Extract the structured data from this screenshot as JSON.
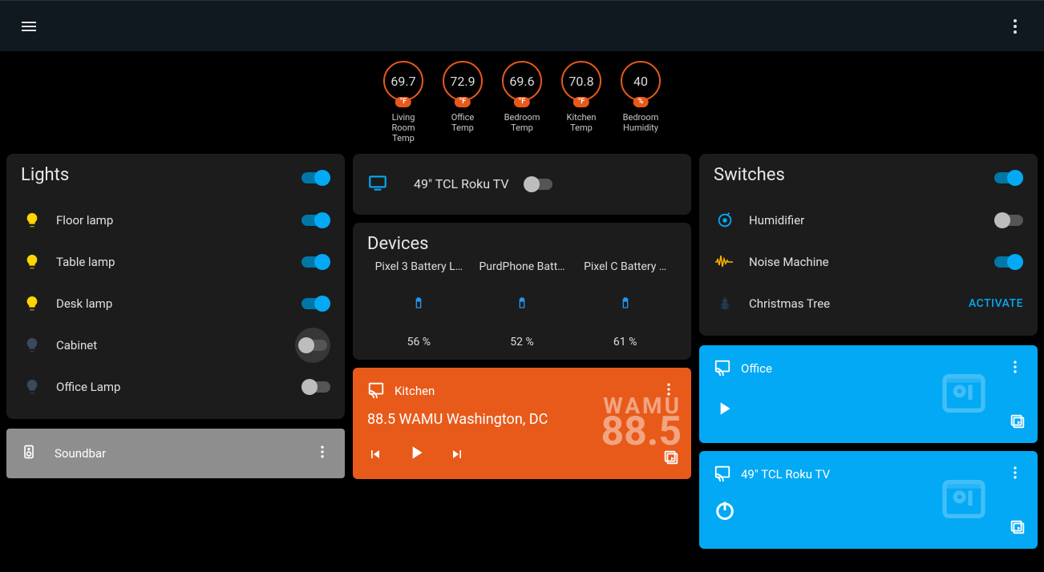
{
  "sensors": [
    {
      "value": "69.7",
      "unit": "°F",
      "label": "Living\nRoom\nTemp"
    },
    {
      "value": "72.9",
      "unit": "°F",
      "label": "Office\nTemp"
    },
    {
      "value": "69.6",
      "unit": "°F",
      "label": "Bedroom\nTemp"
    },
    {
      "value": "70.8",
      "unit": "°F",
      "label": "Kitchen\nTemp"
    },
    {
      "value": "40",
      "unit": "%",
      "label": "Bedroom\nHumidity"
    }
  ],
  "lights": {
    "title": "Lights",
    "master_on": true,
    "items": [
      {
        "name": "Floor lamp",
        "on": true
      },
      {
        "name": "Table lamp",
        "on": true
      },
      {
        "name": "Desk lamp",
        "on": true
      },
      {
        "name": "Cabinet",
        "on": false,
        "halo": true
      },
      {
        "name": "Office Lamp",
        "on": false
      }
    ]
  },
  "soundbar": {
    "name": "Soundbar"
  },
  "tv_row": {
    "name": "49\" TCL Roku TV",
    "on": false
  },
  "devices": {
    "title": "Devices",
    "items": [
      {
        "name": "Pixel 3 Battery L…",
        "value": "56 %"
      },
      {
        "name": "PurdPhone Batt…",
        "value": "52 %"
      },
      {
        "name": "Pixel C Battery …",
        "value": "61 %"
      }
    ]
  },
  "media_kitchen": {
    "cast_label": "Kitchen",
    "title": "88.5 WAMU Washington, DC",
    "bg_line1": "WAMU",
    "bg_line2": "88.5"
  },
  "switches": {
    "title": "Switches",
    "master_on": true,
    "items": [
      {
        "name": "Humidifier",
        "icon": "humidifier",
        "on": false
      },
      {
        "name": "Noise Machine",
        "icon": "wave",
        "on": true
      },
      {
        "name": "Christmas Tree",
        "icon": "tree",
        "action": "ACTIVATE"
      }
    ]
  },
  "media_office": {
    "cast_label": "Office"
  },
  "media_tv": {
    "cast_label": "49\" TCL Roku TV"
  }
}
